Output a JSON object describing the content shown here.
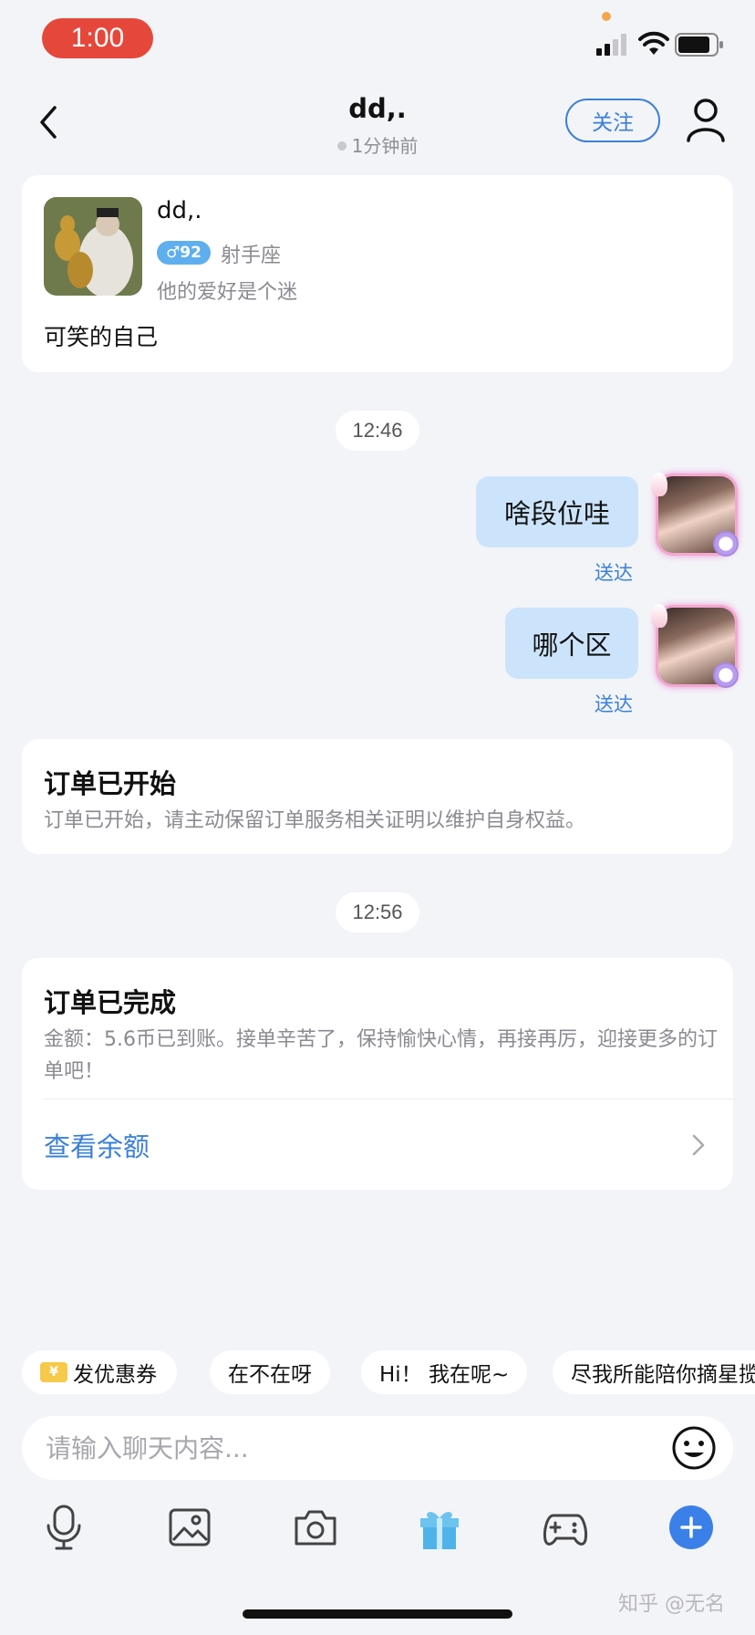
{
  "status_bar": {
    "time": "1:00"
  },
  "nav": {
    "title": "dd,.",
    "subtitle": "1分钟前",
    "follow_label": "关注"
  },
  "profile": {
    "name": "dd,.",
    "gender_age": "♂92",
    "zodiac": "射手座",
    "hobby": "他的爱好是个迷",
    "bio": "可笑的自己"
  },
  "messages": {
    "time1": "12:46",
    "bubble1": "啥段位哇",
    "delivered1": "送达",
    "bubble2": "哪个区",
    "delivered2": "送达",
    "time2": "12:56"
  },
  "order_started": {
    "title": "订单已开始",
    "desc": "订单已开始，请主动保留订单服务相关证明以维护自身权益。"
  },
  "order_completed": {
    "title": "订单已完成",
    "desc": "金额：5.6币已到账。接单辛苦了，保持愉快心情，再接再厉，迎接更多的订单吧！",
    "link": "查看余额"
  },
  "quick_replies": {
    "coupon": "发优惠券",
    "coupon_icon_text": "¥",
    "r1": "在不在呀",
    "r2": "Hi！ 我在呢~",
    "r3": "尽我所能陪你摘星揽月"
  },
  "input": {
    "placeholder": "请输入聊天内容..."
  },
  "watermark": "知乎 @无名",
  "colors": {
    "accent": "#3a80d8",
    "bubble": "#cce4fb",
    "time_pill": "#e5483b",
    "background": "#f3f4f8"
  },
  "icons": [
    "back-icon",
    "profile-icon",
    "emoji-icon",
    "microphone-icon",
    "image-icon",
    "camera-icon",
    "gift-icon",
    "gamepad-icon",
    "plus-icon",
    "chevron-right-icon"
  ]
}
